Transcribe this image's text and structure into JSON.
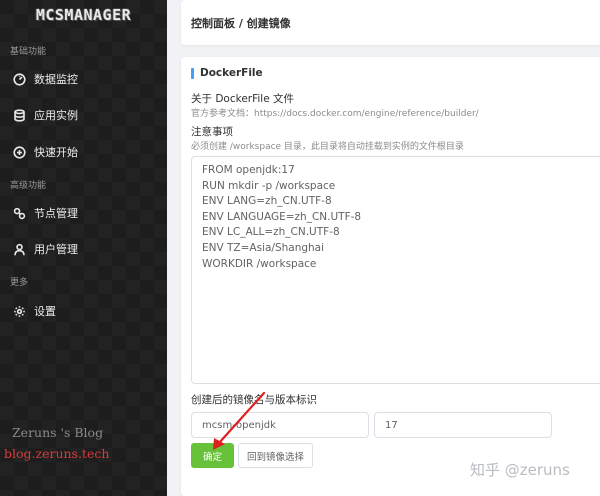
{
  "sidebar": {
    "logo": "MCSMANAGER",
    "sections": [
      {
        "label": "基础功能"
      },
      {
        "label": "高级功能"
      },
      {
        "label": "更多"
      }
    ],
    "items": [
      {
        "label": "数据监控",
        "icon": "dashboard-icon"
      },
      {
        "label": "应用实例",
        "icon": "database-icon"
      },
      {
        "label": "快速开始",
        "icon": "plus-circle-icon"
      },
      {
        "label": "节点管理",
        "icon": "nodes-icon"
      },
      {
        "label": "用户管理",
        "icon": "user-icon"
      },
      {
        "label": "设置",
        "icon": "gear-icon"
      }
    ]
  },
  "watermarks": {
    "blog": "Zeruns 's Blog",
    "site": "blog.zeruns.tech",
    "zhihu": "知乎 @zeruns"
  },
  "breadcrumb": "控制面板 / 创建镜像",
  "dockerfile": {
    "section_title": "DockerFile",
    "about_title": "关于 DockerFile 文件",
    "about_desc": "官方参考文档：https://docs.docker.com/engine/reference/builder/",
    "notice_title": "注意事项",
    "notice_desc": "必须创建 /workspace 目录，此目录将自动挂载到实例的文件根目录",
    "lines": [
      "FROM openjdk:17",
      "RUN mkdir -p /workspace",
      "ENV LANG=zh_CN.UTF-8",
      "ENV LANGUAGE=zh_CN.UTF-8",
      "ENV LC_ALL=zh_CN.UTF-8",
      "ENV TZ=Asia/Shanghai",
      "WORKDIR /workspace"
    ]
  },
  "image": {
    "label": "创建后的镜像名与版本标识",
    "name_value": "mcsm-openjdk",
    "tag_value": "17"
  },
  "buttons": {
    "confirm": "确定",
    "back": "回到镜像选择"
  },
  "colors": {
    "sidebar_bg": "#1d1d1d",
    "accent": "#409eff",
    "confirm": "#67c23a",
    "annotation_arrow": "#e02020"
  }
}
